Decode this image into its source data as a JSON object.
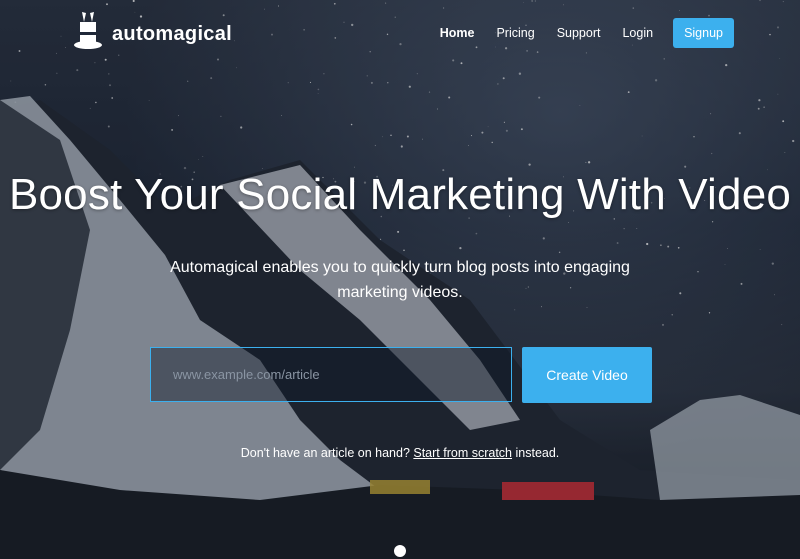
{
  "brand": {
    "name": "automagical",
    "logo_icon": "magic-hat-icon"
  },
  "nav": {
    "items": [
      {
        "label": "Home",
        "active": true
      },
      {
        "label": "Pricing",
        "active": false
      },
      {
        "label": "Support",
        "active": false
      },
      {
        "label": "Login",
        "active": false
      }
    ],
    "signup_label": "Signup"
  },
  "hero": {
    "headline": "Boost Your Social Marketing With Video",
    "subtext": "Automagical enables you to quickly turn blog posts into engaging marketing videos.",
    "input_placeholder": "www.example.com/article",
    "input_value": "",
    "cta_label": "Create Video",
    "scratch_prefix": "Don't have an article on hand?",
    "scratch_link": "Start from scratch",
    "scratch_suffix": "instead."
  },
  "colors": {
    "accent": "#3cb0ee",
    "text": "#ffffff"
  }
}
